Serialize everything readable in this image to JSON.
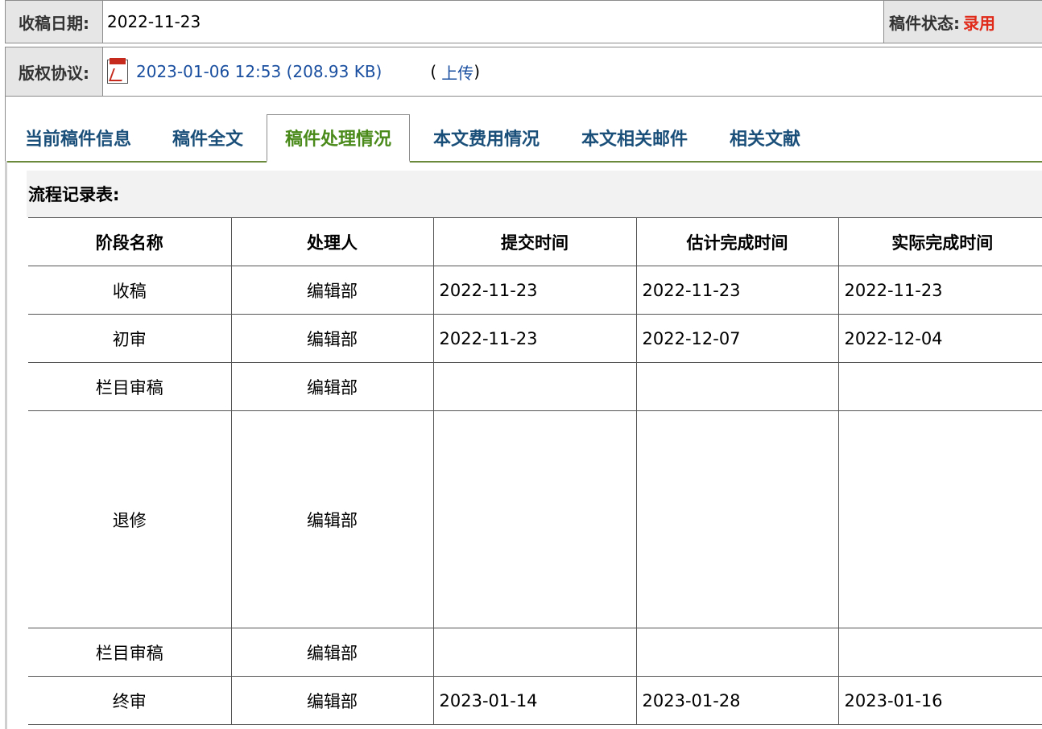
{
  "header": {
    "received_date_label": "收稿日期:",
    "received_date_value": "2022-11-23",
    "status_label": "稿件状态:",
    "status_value": "录用",
    "copyright_label": "版权协议:",
    "copyright_file": "2023-01-06 12:53 (208.93 KB)",
    "upload_prefix": "(",
    "upload_link": "上传",
    "upload_suffix": ")"
  },
  "tabs": [
    {
      "label": "当前稿件信息"
    },
    {
      "label": "稿件全文"
    },
    {
      "label": "稿件处理情况"
    },
    {
      "label": "本文费用情况"
    },
    {
      "label": "本文相关邮件"
    },
    {
      "label": "相关文献"
    }
  ],
  "flow": {
    "title": "流程记录表:",
    "columns": [
      "阶段名称",
      "处理人",
      "提交时间",
      "估计完成时间",
      "实际完成时间"
    ],
    "rows": [
      [
        "收稿",
        "编辑部",
        "2022-11-23",
        "2022-11-23",
        "2022-11-23"
      ],
      [
        "初审",
        "编辑部",
        "2022-11-23",
        "2022-12-07",
        "2022-12-04"
      ],
      [
        "栏目审稿",
        "编辑部",
        "",
        "",
        ""
      ],
      [
        "退修",
        "编辑部",
        "",
        "",
        ""
      ],
      [
        "栏目审稿",
        "编辑部",
        "",
        "",
        ""
      ],
      [
        "终审",
        "编辑部",
        "2023-01-14",
        "2023-01-28",
        "2023-01-16"
      ]
    ]
  },
  "colors": {
    "status": "#e02a1a",
    "active_tab": "#4a8a1a",
    "tab": "#1a4f7a",
    "link": "#1a4fa0"
  },
  "icons": [
    "pdf-file-icon"
  ]
}
